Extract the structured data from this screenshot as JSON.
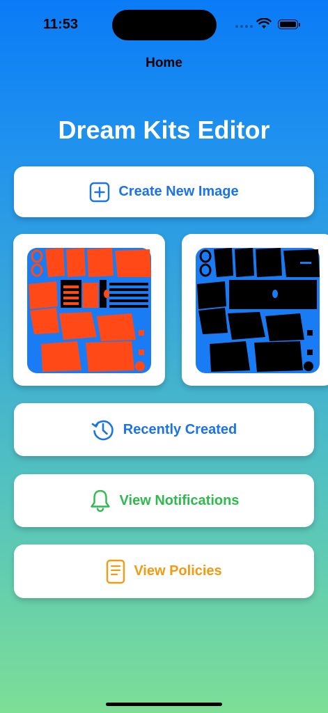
{
  "status_bar": {
    "time": "11:53"
  },
  "nav": {
    "title": "Home"
  },
  "app": {
    "title": "Dream Kits Editor"
  },
  "buttons": {
    "create": {
      "label": "Create New Image",
      "icon": "plus-square-icon",
      "color": "#1a73e8"
    },
    "recent": {
      "label": "Recently Created",
      "icon": "history-icon",
      "color": "#1a73e8"
    },
    "notifications": {
      "label": "View Notifications",
      "icon": "bell-icon",
      "color": "#2fba4d"
    },
    "policies": {
      "label": "View Policies",
      "icon": "document-icon",
      "color": "#f29a12"
    }
  },
  "thumbnails": [
    {
      "icon": "kit-template-orange-thumbnail",
      "background": "#1a7cf4",
      "pieces": "#ff4a17",
      "stripes": "#000000"
    },
    {
      "icon": "kit-template-black-thumbnail",
      "background": "#1a7cf4",
      "pieces": "#000000",
      "stripes": "#1a7cf4"
    }
  ]
}
